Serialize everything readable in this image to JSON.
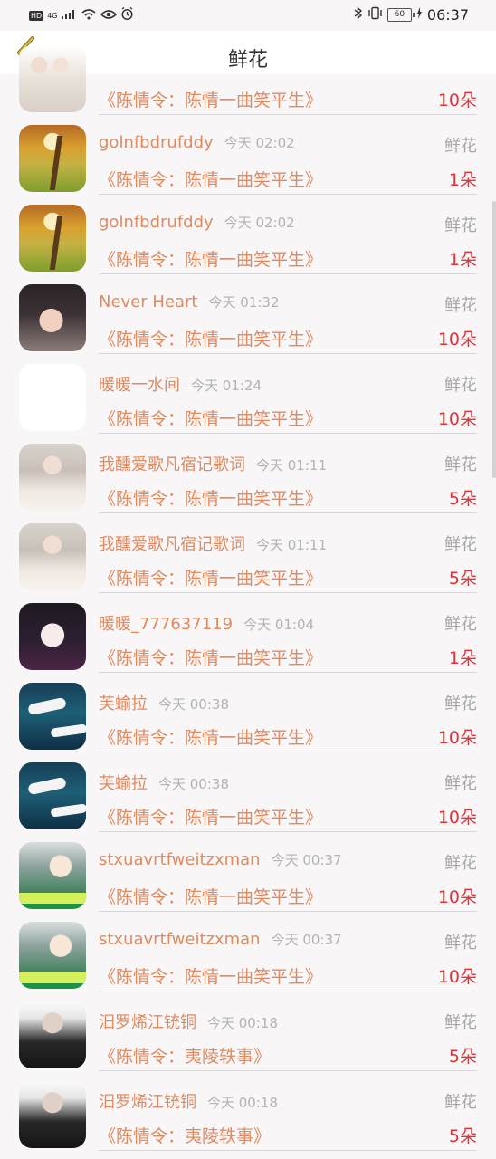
{
  "statusbar": {
    "hd": "HD",
    "network": "4G",
    "battery": "60",
    "time": "06:37"
  },
  "navbar": {
    "title": "鲜花"
  },
  "list": [
    {
      "avatar": "couple",
      "user": "",
      "time": "",
      "gift_label": "",
      "song": "《陈情令：陈情一曲笑平生》",
      "count": "10朵"
    },
    {
      "avatar": "autumn",
      "user": "golnfbdrufddy",
      "time": "今天 02:02",
      "gift_label": "鲜花",
      "song": "《陈情令：陈情一曲笑平生》",
      "count": "1朵"
    },
    {
      "avatar": "autumn",
      "user": "golnfbdrufddy",
      "time": "今天 02:02",
      "gift_label": "鲜花",
      "song": "《陈情令：陈情一曲笑平生》",
      "count": "1朵"
    },
    {
      "avatar": "girl1",
      "user": "Never Heart",
      "time": "今天 01:32",
      "gift_label": "鲜花",
      "song": "《陈情令：陈情一曲笑平生》",
      "count": "10朵"
    },
    {
      "avatar": "white",
      "user": "暖暖一水间",
      "time": "今天 01:24",
      "gift_label": "鲜花",
      "song": "《陈情令：陈情一曲笑平生》",
      "count": "10朵"
    },
    {
      "avatar": "girl2",
      "user": "我醺爱歌凡宿记歌词",
      "time": "今天 01:11",
      "gift_label": "鲜花",
      "song": "《陈情令：陈情一曲笑平生》",
      "count": "5朵"
    },
    {
      "avatar": "girl2",
      "user": "我醺爱歌凡宿记歌词",
      "time": "今天 01:11",
      "gift_label": "鲜花",
      "song": "《陈情令：陈情一曲笑平生》",
      "count": "5朵"
    },
    {
      "avatar": "girl3",
      "user": "暖暖_777637119",
      "time": "今天 01:04",
      "gift_label": "鲜花",
      "song": "《陈情令：陈情一曲笑平生》",
      "count": "1朵"
    },
    {
      "avatar": "boat",
      "user": "芙蝓拉",
      "time": "今天 00:38",
      "gift_label": "鲜花",
      "song": "《陈情令：陈情一曲笑平生》",
      "count": "10朵"
    },
    {
      "avatar": "boat",
      "user": "芙蝓拉",
      "time": "今天 00:38",
      "gift_label": "鲜花",
      "song": "《陈情令：陈情一曲笑平生》",
      "count": "10朵"
    },
    {
      "avatar": "anime",
      "user": "stxuavrtfweitzxman",
      "time": "今天 00:37",
      "gift_label": "鲜花",
      "song": "《陈情令：陈情一曲笑平生》",
      "count": "10朵"
    },
    {
      "avatar": "anime",
      "user": "stxuavrtfweitzxman",
      "time": "今天 00:37",
      "gift_label": "鲜花",
      "song": "《陈情令：陈情一曲笑平生》",
      "count": "10朵"
    },
    {
      "avatar": "sunglass",
      "user": "汨罗烯江铳铜",
      "time": "今天 00:18",
      "gift_label": "鲜花",
      "song": "《陈情令：夷陵轶事》",
      "count": "5朵"
    },
    {
      "avatar": "sunglass",
      "user": "汨罗烯江铳铜",
      "time": "今天 00:18",
      "gift_label": "鲜花",
      "song": "《陈情令：夷陵轶事》",
      "count": "5朵"
    }
  ]
}
